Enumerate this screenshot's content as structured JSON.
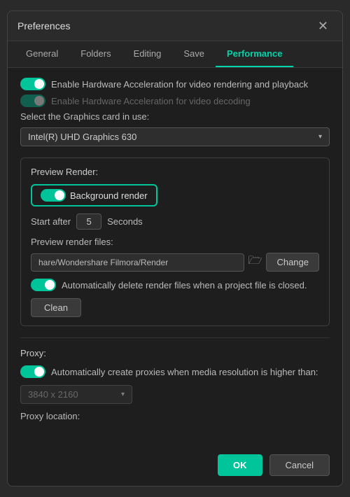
{
  "dialog": {
    "title": "Preferences",
    "close_label": "✕"
  },
  "tabs": [
    {
      "id": "general",
      "label": "General",
      "active": false
    },
    {
      "id": "folders",
      "label": "Folders",
      "active": false
    },
    {
      "id": "editing",
      "label": "Editing",
      "active": false
    },
    {
      "id": "save",
      "label": "Save",
      "active": false
    },
    {
      "id": "performance",
      "label": "Performance",
      "active": true
    }
  ],
  "hw_accel": {
    "row1_label": "Enable Hardware Acceleration for video rendering and playback",
    "row1_on": true,
    "row2_label": "Enable Hardware Acceleration for video decoding",
    "row2_on": true,
    "row2_disabled": true
  },
  "graphics_card": {
    "label": "Select the Graphics card in use:",
    "value": "Intel(R) UHD Graphics 630"
  },
  "preview_render": {
    "section_label": "Preview Render:",
    "bg_render_label": "Background render",
    "bg_render_on": true,
    "start_after_label": "Start after",
    "start_after_value": "5",
    "seconds_label": "Seconds",
    "files_label": "Preview render files:",
    "file_path": "hare/Wondershare Filmora/Render",
    "change_btn_label": "Change",
    "auto_delete_label": "Automatically delete render files when a project file is closed.",
    "auto_delete_on": true,
    "clean_btn_label": "Clean"
  },
  "proxy": {
    "section_label": "Proxy:",
    "auto_create_label": "Automatically create proxies when media resolution is higher than:",
    "auto_create_on": true,
    "resolution_value": "3840 x 2160",
    "location_label": "Proxy location:"
  },
  "footer": {
    "ok_label": "OK",
    "cancel_label": "Cancel"
  }
}
